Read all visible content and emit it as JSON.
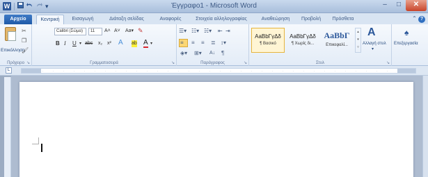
{
  "window": {
    "title": "Έγγραφο1 - Microsoft Word",
    "minimize": "–",
    "maximize": "□",
    "close": "✕"
  },
  "quick_access": {
    "app_icon": "W",
    "save_icon": "save-icon",
    "undo_icon": "undo-icon",
    "redo_icon": "redo-icon",
    "customize_icon": "dropdown-icon"
  },
  "tabs": [
    {
      "label": "Αρχείο",
      "state": "file"
    },
    {
      "label": "Κεντρική",
      "state": "active"
    },
    {
      "label": "Εισαγωγή",
      "state": "normal"
    },
    {
      "label": "Διάταξη σελίδας",
      "state": "normal"
    },
    {
      "label": "Αναφορές",
      "state": "normal"
    },
    {
      "label": "Στοιχεία αλληλογραφίας",
      "state": "normal"
    },
    {
      "label": "Αναθεώρηση",
      "state": "normal"
    },
    {
      "label": "Προβολή",
      "state": "normal"
    },
    {
      "label": "Πρόσθετα",
      "state": "normal"
    }
  ],
  "ribbon": {
    "clipboard": {
      "label": "Πρόχειρο",
      "paste_label": "Επικόλληση"
    },
    "font": {
      "label": "Γραμματοσειρά",
      "font_name": "Calibri (Σώμα)",
      "font_size": "11",
      "grow": "A˄",
      "shrink": "A˅",
      "change_case": "Aa▾",
      "bold": "B",
      "italic": "I",
      "underline": "U",
      "strikethrough": "abc",
      "subscript": "x₂",
      "superscript": "x²",
      "text_effects": "A",
      "highlight": "ab",
      "font_color": "A"
    },
    "paragraph": {
      "label": "Παράγραφος",
      "pilcrow": "¶",
      "sort": "A↓"
    },
    "styles": {
      "label": "Στυλ",
      "items": [
        {
          "sample": "AaBbΓγΔδ",
          "name": "¶ Βασικό"
        },
        {
          "sample": "AaBbΓγΔδ",
          "name": "¶ Χωρίς δι..."
        },
        {
          "sample": "AaBbΓ",
          "name": "Επικεφαλί..."
        }
      ],
      "change_styles": "Αλλαγή στυλ",
      "change_styles_arrow": "▾",
      "editing": "Επεξεργασία"
    }
  },
  "colors": {
    "accent": "#2b579a",
    "file_tab": "#1f5aa8",
    "selected_style": "#e6b43c",
    "highlight_yellow": "#fbd775",
    "font_red": "#d9272e"
  }
}
